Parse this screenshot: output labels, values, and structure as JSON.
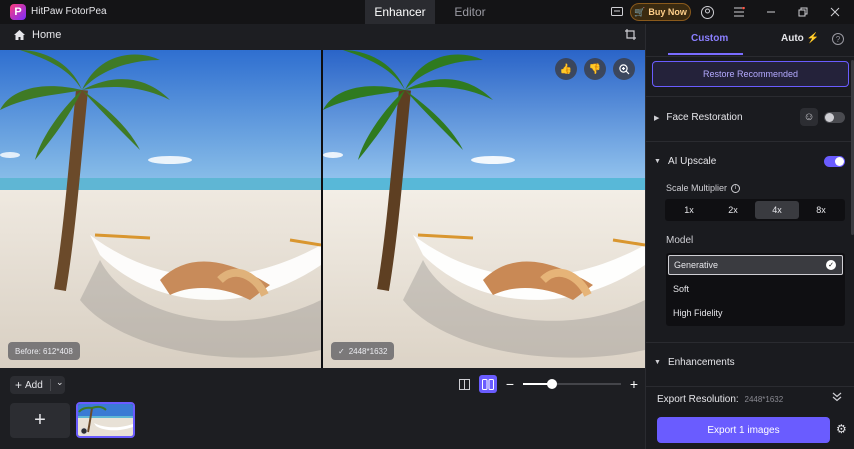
{
  "titlebar": {
    "app_name": "HitPaw FotorPea",
    "tabs": [
      {
        "label": "Enhancer",
        "active": true
      },
      {
        "label": "Editor",
        "active": false
      }
    ],
    "buy_now": "Buy Now",
    "icons": [
      "chat-icon",
      "cart-icon",
      "user-icon",
      "menu-icon",
      "minimize-icon",
      "restore-icon",
      "close-icon"
    ]
  },
  "toolbar": {
    "home_label": "Home"
  },
  "viewer": {
    "before_label": "Before: 612*408",
    "after_label": "2448*1632"
  },
  "bottom": {
    "add_label": "Add",
    "zoom_level": 0.3
  },
  "panel": {
    "tab_custom": "Custom",
    "tab_auto": "Auto",
    "restore": "Restore Recommended",
    "face_restoration": "Face Restoration",
    "face_restoration_enabled": false,
    "ai_upscale": "AI Upscale",
    "ai_upscale_enabled": true,
    "scale_label": "Scale Multiplier",
    "scales": [
      "1x",
      "2x",
      "4x",
      "8x"
    ],
    "scale_selected": "4x",
    "model_label": "Model",
    "models": [
      "Generative",
      "Soft",
      "High Fidelity"
    ],
    "model_selected": "Generative",
    "enhancements": "Enhancements",
    "export_res_label": "Export Resolution:",
    "export_res_value": "2448*1632",
    "export_button": "Export 1 images"
  },
  "colors": {
    "accent": "#6a5cff",
    "buy": "#ff9f2e"
  }
}
